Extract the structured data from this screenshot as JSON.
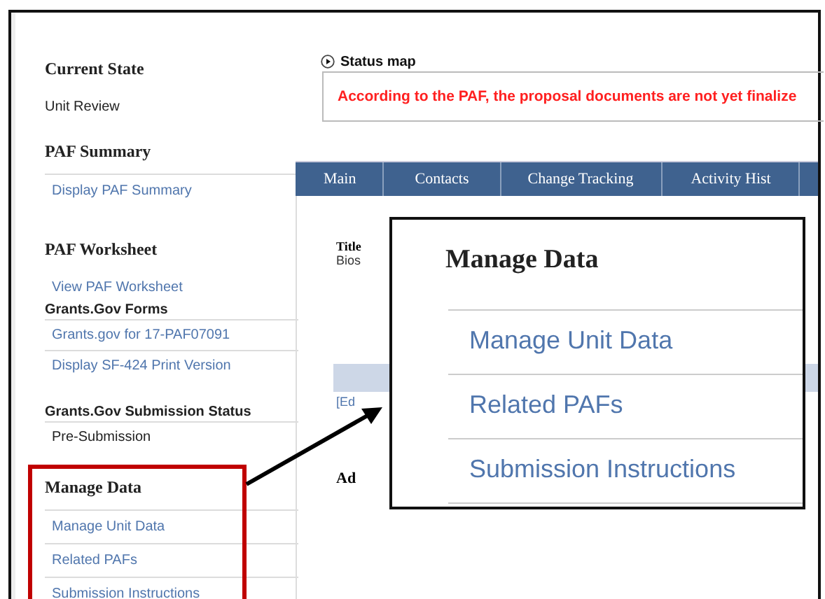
{
  "sidebar": {
    "sections": [
      {
        "kind": "section",
        "heading": "Current State",
        "divided": false,
        "items": [
          {
            "label": "Unit Review",
            "kind": "text"
          }
        ]
      },
      {
        "kind": "section",
        "heading": "PAF Summary",
        "divided": true,
        "items": [
          {
            "label": "Display PAF Summary",
            "kind": "link"
          }
        ]
      },
      {
        "kind": "section",
        "heading": "PAF Worksheet",
        "divided": false,
        "items": [
          {
            "label": "View PAF Worksheet",
            "kind": "link"
          }
        ]
      },
      {
        "kind": "subsection",
        "heading": "Grants.Gov Forms",
        "divided": true,
        "items": [
          {
            "label": "Grants.gov for 17-PAF07091",
            "kind": "link"
          },
          {
            "label": "Display SF-424 Print Version",
            "kind": "link"
          }
        ]
      },
      {
        "kind": "subsection",
        "heading": "Grants.Gov Submission Status",
        "divided": true,
        "items": [
          {
            "label": "Pre-Submission",
            "kind": "text"
          }
        ]
      },
      {
        "kind": "section",
        "heading": "Manage Data",
        "divided": true,
        "items": [
          {
            "label": "Manage Unit Data",
            "kind": "link"
          },
          {
            "label": "Related PAFs",
            "kind": "link"
          },
          {
            "label": "Submission Instructions",
            "kind": "link"
          }
        ]
      }
    ]
  },
  "status_map": {
    "label": "Status map",
    "message": "According to the PAF, the proposal documents are not yet finalize"
  },
  "tabs": [
    "Main",
    "Contacts",
    "Change Tracking",
    "Activity Hist"
  ],
  "content": {
    "title_label": "Title",
    "title_value": "Bios",
    "edit_link": "[Ed",
    "heading": "Ad"
  },
  "callout": {
    "title": "Manage Data",
    "items": [
      "Manage Unit Data",
      "Related PAFs",
      "Submission Instructions"
    ]
  }
}
